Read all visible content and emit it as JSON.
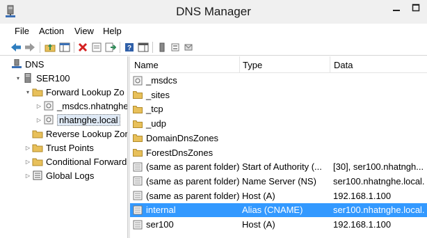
{
  "window": {
    "title": "DNS Manager"
  },
  "menu": [
    "File",
    "Action",
    "View",
    "Help"
  ],
  "toolbar_icons": [
    "back-arrow-icon",
    "forward-arrow-icon",
    "up-folder-icon",
    "show-hide-tree-icon",
    "delete-icon",
    "properties-icon",
    "export-list-icon",
    "help-icon",
    "show-hide-action-pane-icon",
    "new-host-icon",
    "new-alias-icon",
    "new-mail-exchanger-icon"
  ],
  "tree": [
    {
      "label": "DNS",
      "icon": "dns-icon",
      "expander": ""
    },
    {
      "label": "SER100",
      "icon": "server-icon",
      "expander": "▾"
    },
    {
      "label": "Forward Lookup Zo",
      "icon": "folder-icon",
      "expander": "▾"
    },
    {
      "label": "_msdcs.nhatnghe",
      "icon": "zone-icon",
      "expander": "▷"
    },
    {
      "label": "nhatnghe.local",
      "icon": "zone-icon",
      "expander": "▷"
    },
    {
      "label": "Reverse Lookup Zor",
      "icon": "folder-icon",
      "expander": ""
    },
    {
      "label": "Trust Points",
      "icon": "folder-icon",
      "expander": "▷"
    },
    {
      "label": "Conditional Forward",
      "icon": "folder-icon",
      "expander": "▷"
    },
    {
      "label": "Global Logs",
      "icon": "log-icon",
      "expander": "▷"
    }
  ],
  "list": {
    "columns": [
      "Name",
      "Type",
      "Data"
    ],
    "rows": [
      {
        "name": "_msdcs",
        "type": "",
        "data": "",
        "icon": "zone-icon"
      },
      {
        "name": "_sites",
        "type": "",
        "data": "",
        "icon": "folder-icon"
      },
      {
        "name": "_tcp",
        "type": "",
        "data": "",
        "icon": "folder-icon"
      },
      {
        "name": "_udp",
        "type": "",
        "data": "",
        "icon": "folder-icon"
      },
      {
        "name": "DomainDnsZones",
        "type": "",
        "data": "",
        "icon": "folder-icon"
      },
      {
        "name": "ForestDnsZones",
        "type": "",
        "data": "",
        "icon": "folder-icon"
      },
      {
        "name": "(same as parent folder)",
        "type": "Start of Authority (...",
        "data": "[30], ser100.nhatngh...",
        "icon": "record-icon"
      },
      {
        "name": "(same as parent folder)",
        "type": "Name Server (NS)",
        "data": "ser100.nhatnghe.local.",
        "icon": "record-icon"
      },
      {
        "name": "(same as parent folder)",
        "type": "Host (A)",
        "data": "192.168.1.100",
        "icon": "record-icon"
      },
      {
        "name": "internal",
        "type": "Alias (CNAME)",
        "data": "ser100.nhatnghe.local.",
        "icon": "record-icon",
        "selected": true
      },
      {
        "name": "ser100",
        "type": "Host (A)",
        "data": "192.168.1.100",
        "icon": "record-icon"
      }
    ]
  },
  "colors": {
    "selection": "#3399ff",
    "folder": "#e8c05a",
    "toolbar_green": "#2e8b57"
  }
}
